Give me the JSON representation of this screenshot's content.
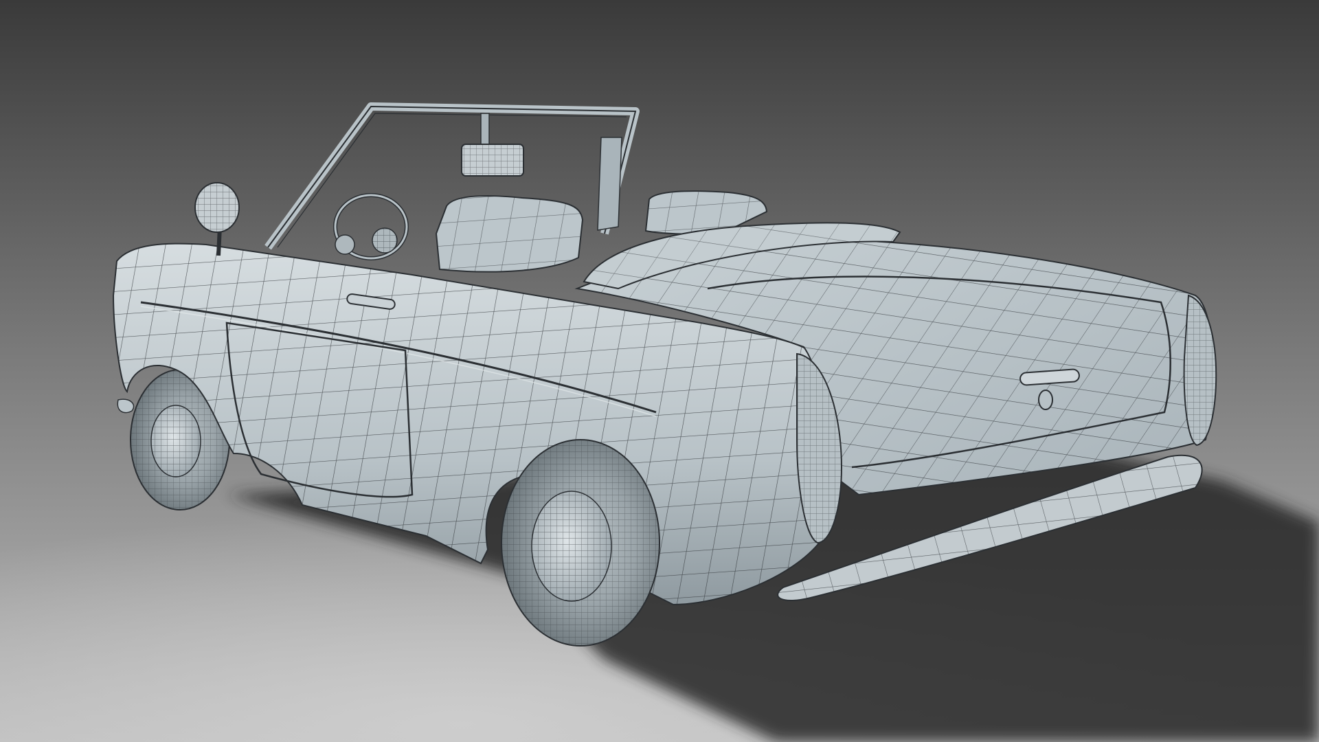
{
  "scene": {
    "subject": "wireframe-convertible-car-render",
    "colors": {
      "background_top": "#3b3b3b",
      "background_bottom": "#b9b9b9",
      "floor_light": "#c8c8c8",
      "shadow": "#2a2a2a",
      "body": "#b9c3c8",
      "body_light": "#d4dadd",
      "body_dark": "#8c979d",
      "wire": "#2b2f33",
      "tire": "#7e878c"
    }
  }
}
